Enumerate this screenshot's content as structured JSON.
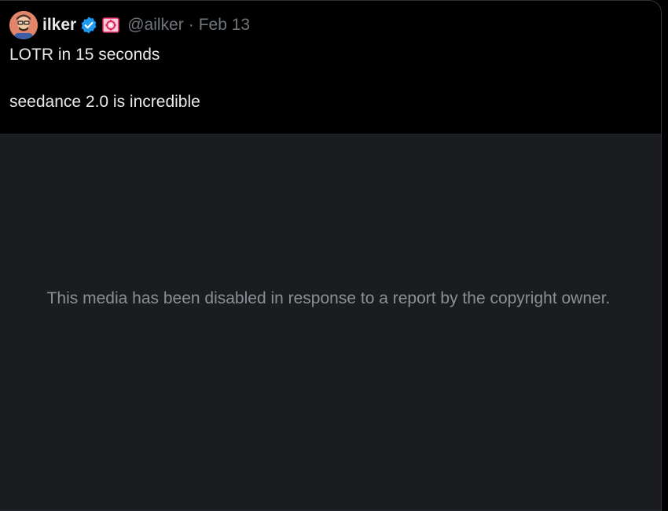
{
  "tweet": {
    "author": {
      "display_name": "ilker",
      "handle": "@ailker",
      "avatar_icon": "avatar-illustration",
      "verified_icon": "verified-badge-icon",
      "affiliate_icon": "affiliate-badge-icon"
    },
    "separator": "·",
    "date": "Feb 13",
    "text_lines": [
      "LOTR in 15 seconds",
      "seedance 2.0 is incredible"
    ],
    "media": {
      "disabled_message": "This media has been disabled in response to a report by the copyright owner."
    }
  },
  "colors": {
    "background": "#000000",
    "media_background": "#1b1c20",
    "primary_text": "#e7e9ea",
    "secondary_text": "#71767b",
    "verified_blue": "#1d9bf0",
    "affiliate_pink": "#e0245e"
  }
}
